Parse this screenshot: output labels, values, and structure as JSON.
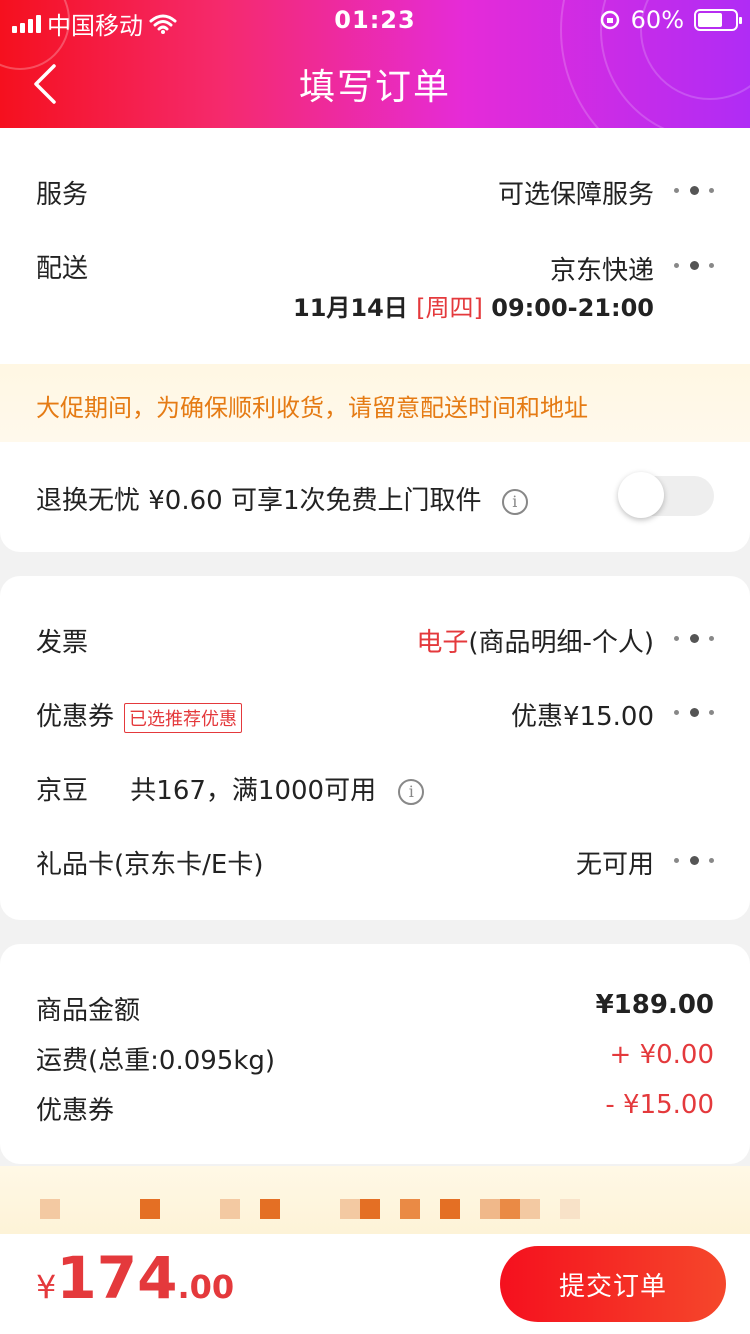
{
  "status_bar": {
    "carrier": "中国移动",
    "time": "01:23",
    "battery": "60%"
  },
  "nav": {
    "title": "填写订单"
  },
  "service": {
    "label": "服务",
    "value": "可选保障服务"
  },
  "delivery": {
    "label": "配送",
    "value": "京东快递",
    "date": "11月14日",
    "weekday": "[周四]",
    "time_range": "09:00-21:00"
  },
  "notice": "大促期间，为确保顺利收货，请留意配送时间和地址",
  "return_service": {
    "text": "退换无忧 ¥0.60 可享1次免费上门取件",
    "enabled": false
  },
  "invoice": {
    "label": "发票",
    "type": "电子",
    "detail": "(商品明细-个人)"
  },
  "coupon": {
    "label": "优惠券",
    "tag": "已选推荐优惠",
    "value": "优惠¥15.00"
  },
  "jingdou": {
    "label": "京豆",
    "value": "共167，满1000可用"
  },
  "gift_card": {
    "label": "礼品卡(京东卡/E卡)",
    "value": "无可用"
  },
  "summary": {
    "goods_label": "商品金额",
    "goods_amount": "¥189.00",
    "shipping_label": "运费(总重:0.095kg)",
    "shipping_amount": "+ ¥0.00",
    "coupon_label": "优惠券",
    "coupon_amount": "- ¥15.00"
  },
  "bottom": {
    "currency": "¥",
    "total_int": "174",
    "total_dec": ".00",
    "submit_label": "提交订单"
  },
  "colors": {
    "accent_red": "#e4393c",
    "notice_orange": "#e57b14"
  }
}
